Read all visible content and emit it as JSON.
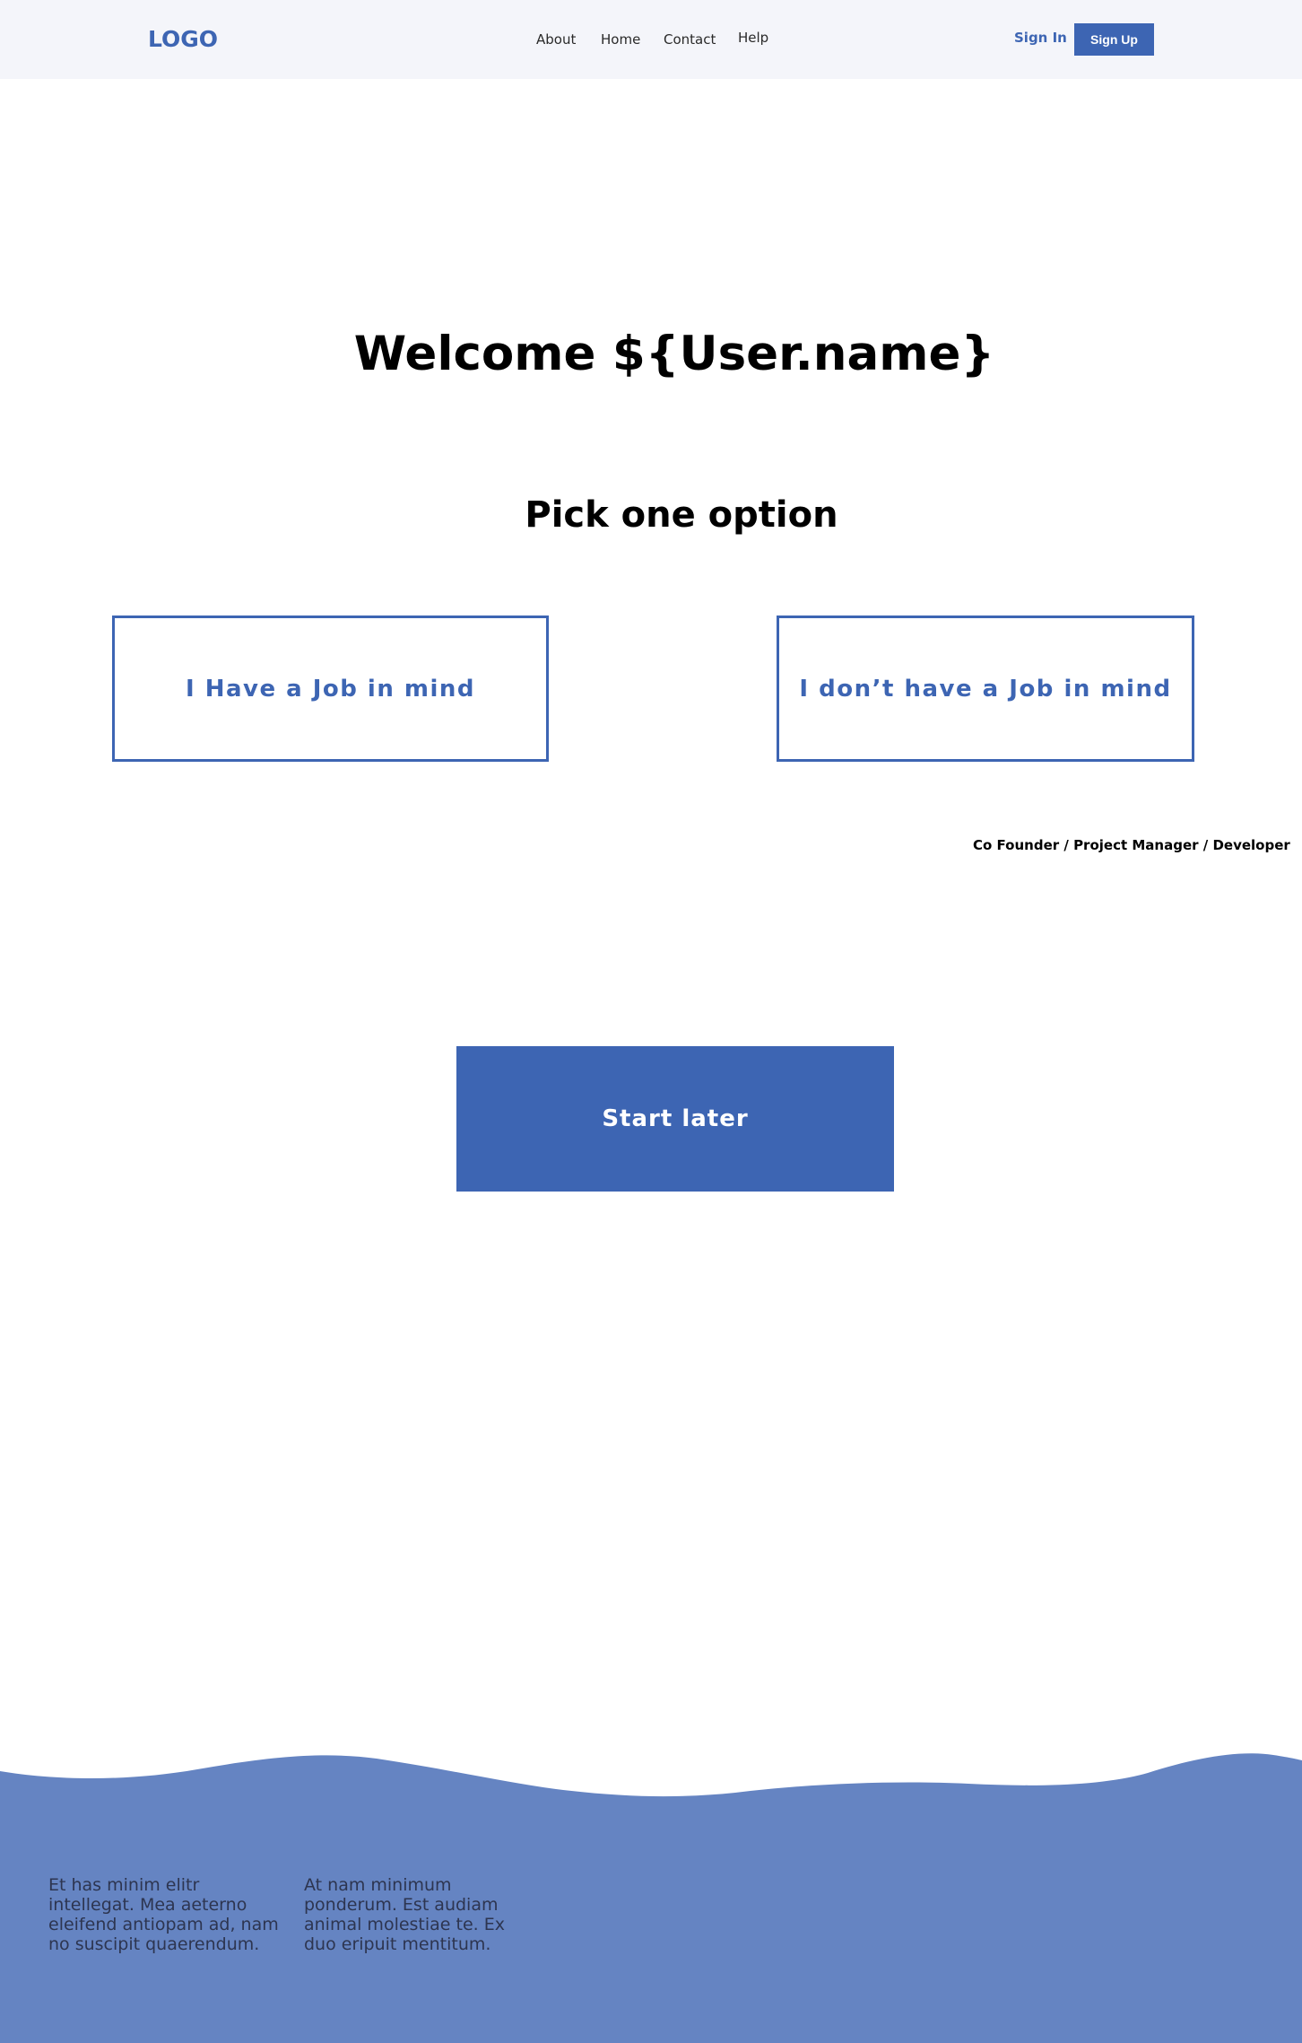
{
  "header": {
    "logo": "LOGO",
    "nav": [
      {
        "label": "About"
      },
      {
        "label": "Home"
      },
      {
        "label": "Contact"
      },
      {
        "label": "Help"
      }
    ],
    "sign_in": "Sign In",
    "sign_up": "Sign Up"
  },
  "main": {
    "welcome": "Welcome ${User.name}",
    "pick_title": "Pick one option",
    "options": [
      {
        "label": "I Have a Job in mind"
      },
      {
        "label": "I don’t have a Job in mind"
      }
    ],
    "roles": "Co Founder / Project Manager / Developer",
    "start_later": "Start later"
  },
  "footer": {
    "col1": "Et has minim elitr intellegat. Mea aeterno eleifend antiopam ad, nam no suscipit quaerendum.",
    "col2": "At nam minimum ponderum. Est audiam animal molestiae te. Ex duo eripuit mentitum."
  },
  "colors": {
    "accent": "#3d65b3",
    "header_bg": "#f4f5fa",
    "footer_bg": "#6584c2"
  }
}
